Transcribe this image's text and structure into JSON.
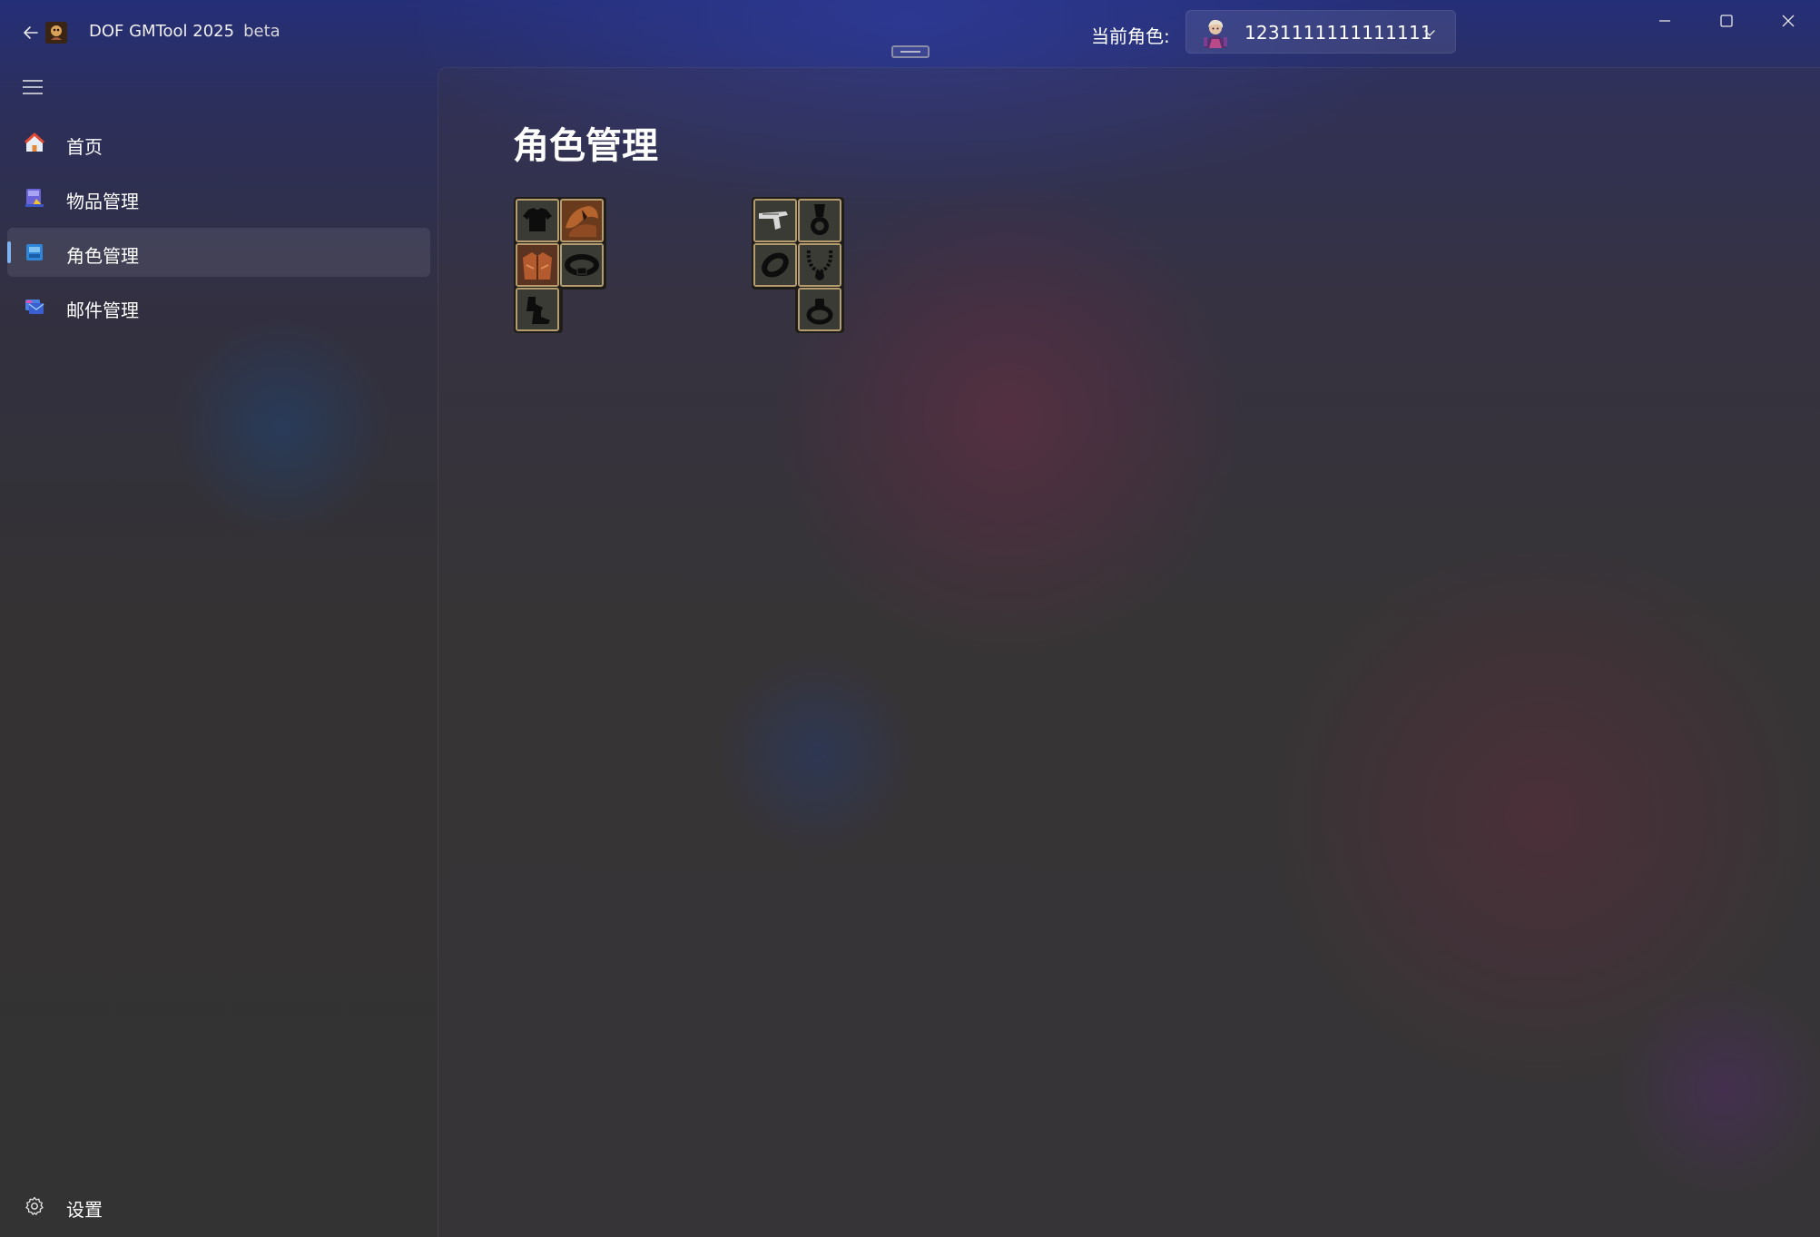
{
  "titlebar": {
    "app_name": "DOF GMTool 2025",
    "badge": "beta",
    "character_label": "当前角色:",
    "character_value": "1231111111111111",
    "icons": {
      "back": "back-arrow-icon",
      "app": "app-logo-icon",
      "chevron": "chevron-down-icon",
      "minimize": "minimize-icon",
      "maximize": "maximize-icon",
      "close": "close-icon"
    }
  },
  "sidebar": {
    "items": [
      {
        "label": "首页",
        "icon": "home-icon"
      },
      {
        "label": "物品管理",
        "icon": "items-icon"
      },
      {
        "label": "角色管理",
        "icon": "character-icon",
        "active": true
      },
      {
        "label": "邮件管理",
        "icon": "mail-icon"
      }
    ],
    "footer": {
      "label": "设置",
      "icon": "gear-icon"
    }
  },
  "main": {
    "title": "角色管理",
    "armor_slots": [
      "shirt",
      "shoulder",
      "jacket",
      "belt",
      "shoes"
    ],
    "accessory_slots": [
      "weapon",
      "title-medal",
      "bracelet",
      "necklace",
      "ring"
    ]
  },
  "colors": {
    "accent": "#7fb3f0",
    "slot_border": "#b59c6e",
    "titlebar": "#252f78",
    "background": "#333333"
  }
}
